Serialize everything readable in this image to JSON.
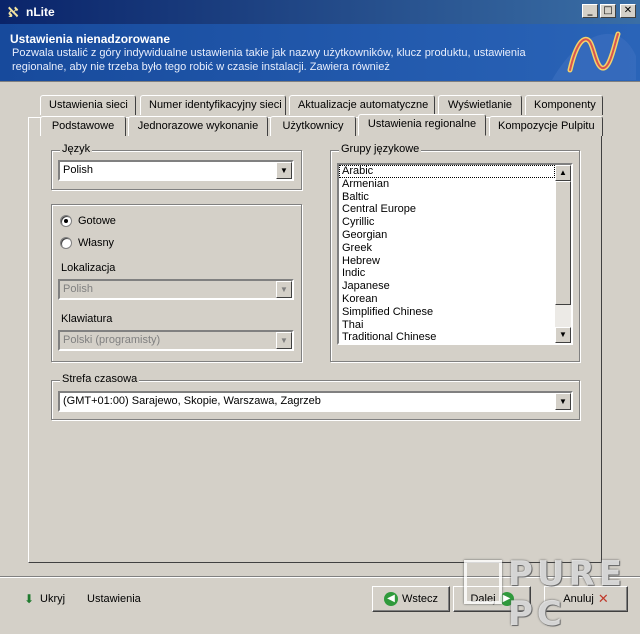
{
  "window": {
    "title": "nLite"
  },
  "header": {
    "title": "Ustawienia nienadzorowane",
    "description": "Pozwala ustalić z góry indywidualne ustawienia takie jak nazwy użytkowników, klucz produktu, ustawienia regionalne, aby nie trzeba było tego robić w czasie instalacji. Zawiera również"
  },
  "tabs_row1": [
    "Ustawienia sieci",
    "Numer identyfikacyjny sieci",
    "Aktualizacje automatyczne",
    "Wyświetlanie",
    "Komponenty"
  ],
  "tabs_row2": [
    "Podstawowe",
    "Jednorazowe wykonanie",
    "Użytkownicy",
    "Ustawienia regionalne",
    "Kompozycje Pulpitu"
  ],
  "language": {
    "label": "Język",
    "value": "Polish"
  },
  "mode": {
    "option_ready": "Gotowe",
    "option_custom": "Własny",
    "selected": "Gotowe",
    "locale_label": "Lokalizacja",
    "locale_value": "Polish",
    "keyboard_label": "Klawiatura",
    "keyboard_value": "Polski (programisty)"
  },
  "language_groups": {
    "label": "Grupy językowe",
    "items": [
      "Arabic",
      "Armenian",
      "Baltic",
      "Central Europe",
      "Cyrillic",
      "Georgian",
      "Greek",
      "Hebrew",
      "Indic",
      "Japanese",
      "Korean",
      "Simplified Chinese",
      "Thai",
      "Traditional Chinese"
    ]
  },
  "timezone": {
    "label": "Strefa czasowa",
    "value": "(GMT+01:00) Sarajewo, Skopie, Warszawa, Zagrzeb"
  },
  "bottom": {
    "hide_label": "Ukryj",
    "settings_label": "Ustawienia",
    "back_label": "Wstecz",
    "next_label": "Dalej",
    "cancel_label": "Anuluj"
  },
  "watermark": {
    "text": "PURE PC"
  }
}
